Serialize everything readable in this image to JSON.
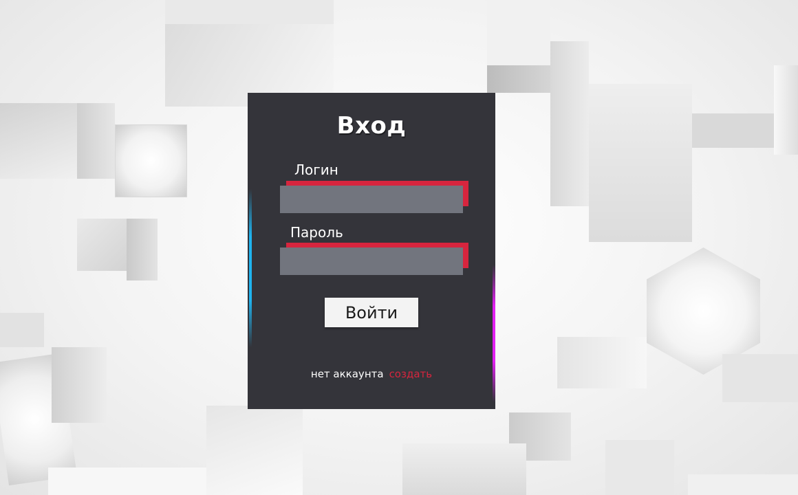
{
  "page": {
    "title": "Вход"
  },
  "form": {
    "login_label": "Логин",
    "login_value": "",
    "password_label": "Пароль",
    "password_value": "",
    "submit_label": "Войти"
  },
  "footer": {
    "no_account_text": "нет аккаунта",
    "create_link_label": "создать"
  },
  "colors": {
    "card_bg": "#34343a",
    "accent_red": "#d7253e",
    "field_gray": "#72757e",
    "edge_blue": "#1fb4f0",
    "edge_magenta": "#e020f0"
  }
}
